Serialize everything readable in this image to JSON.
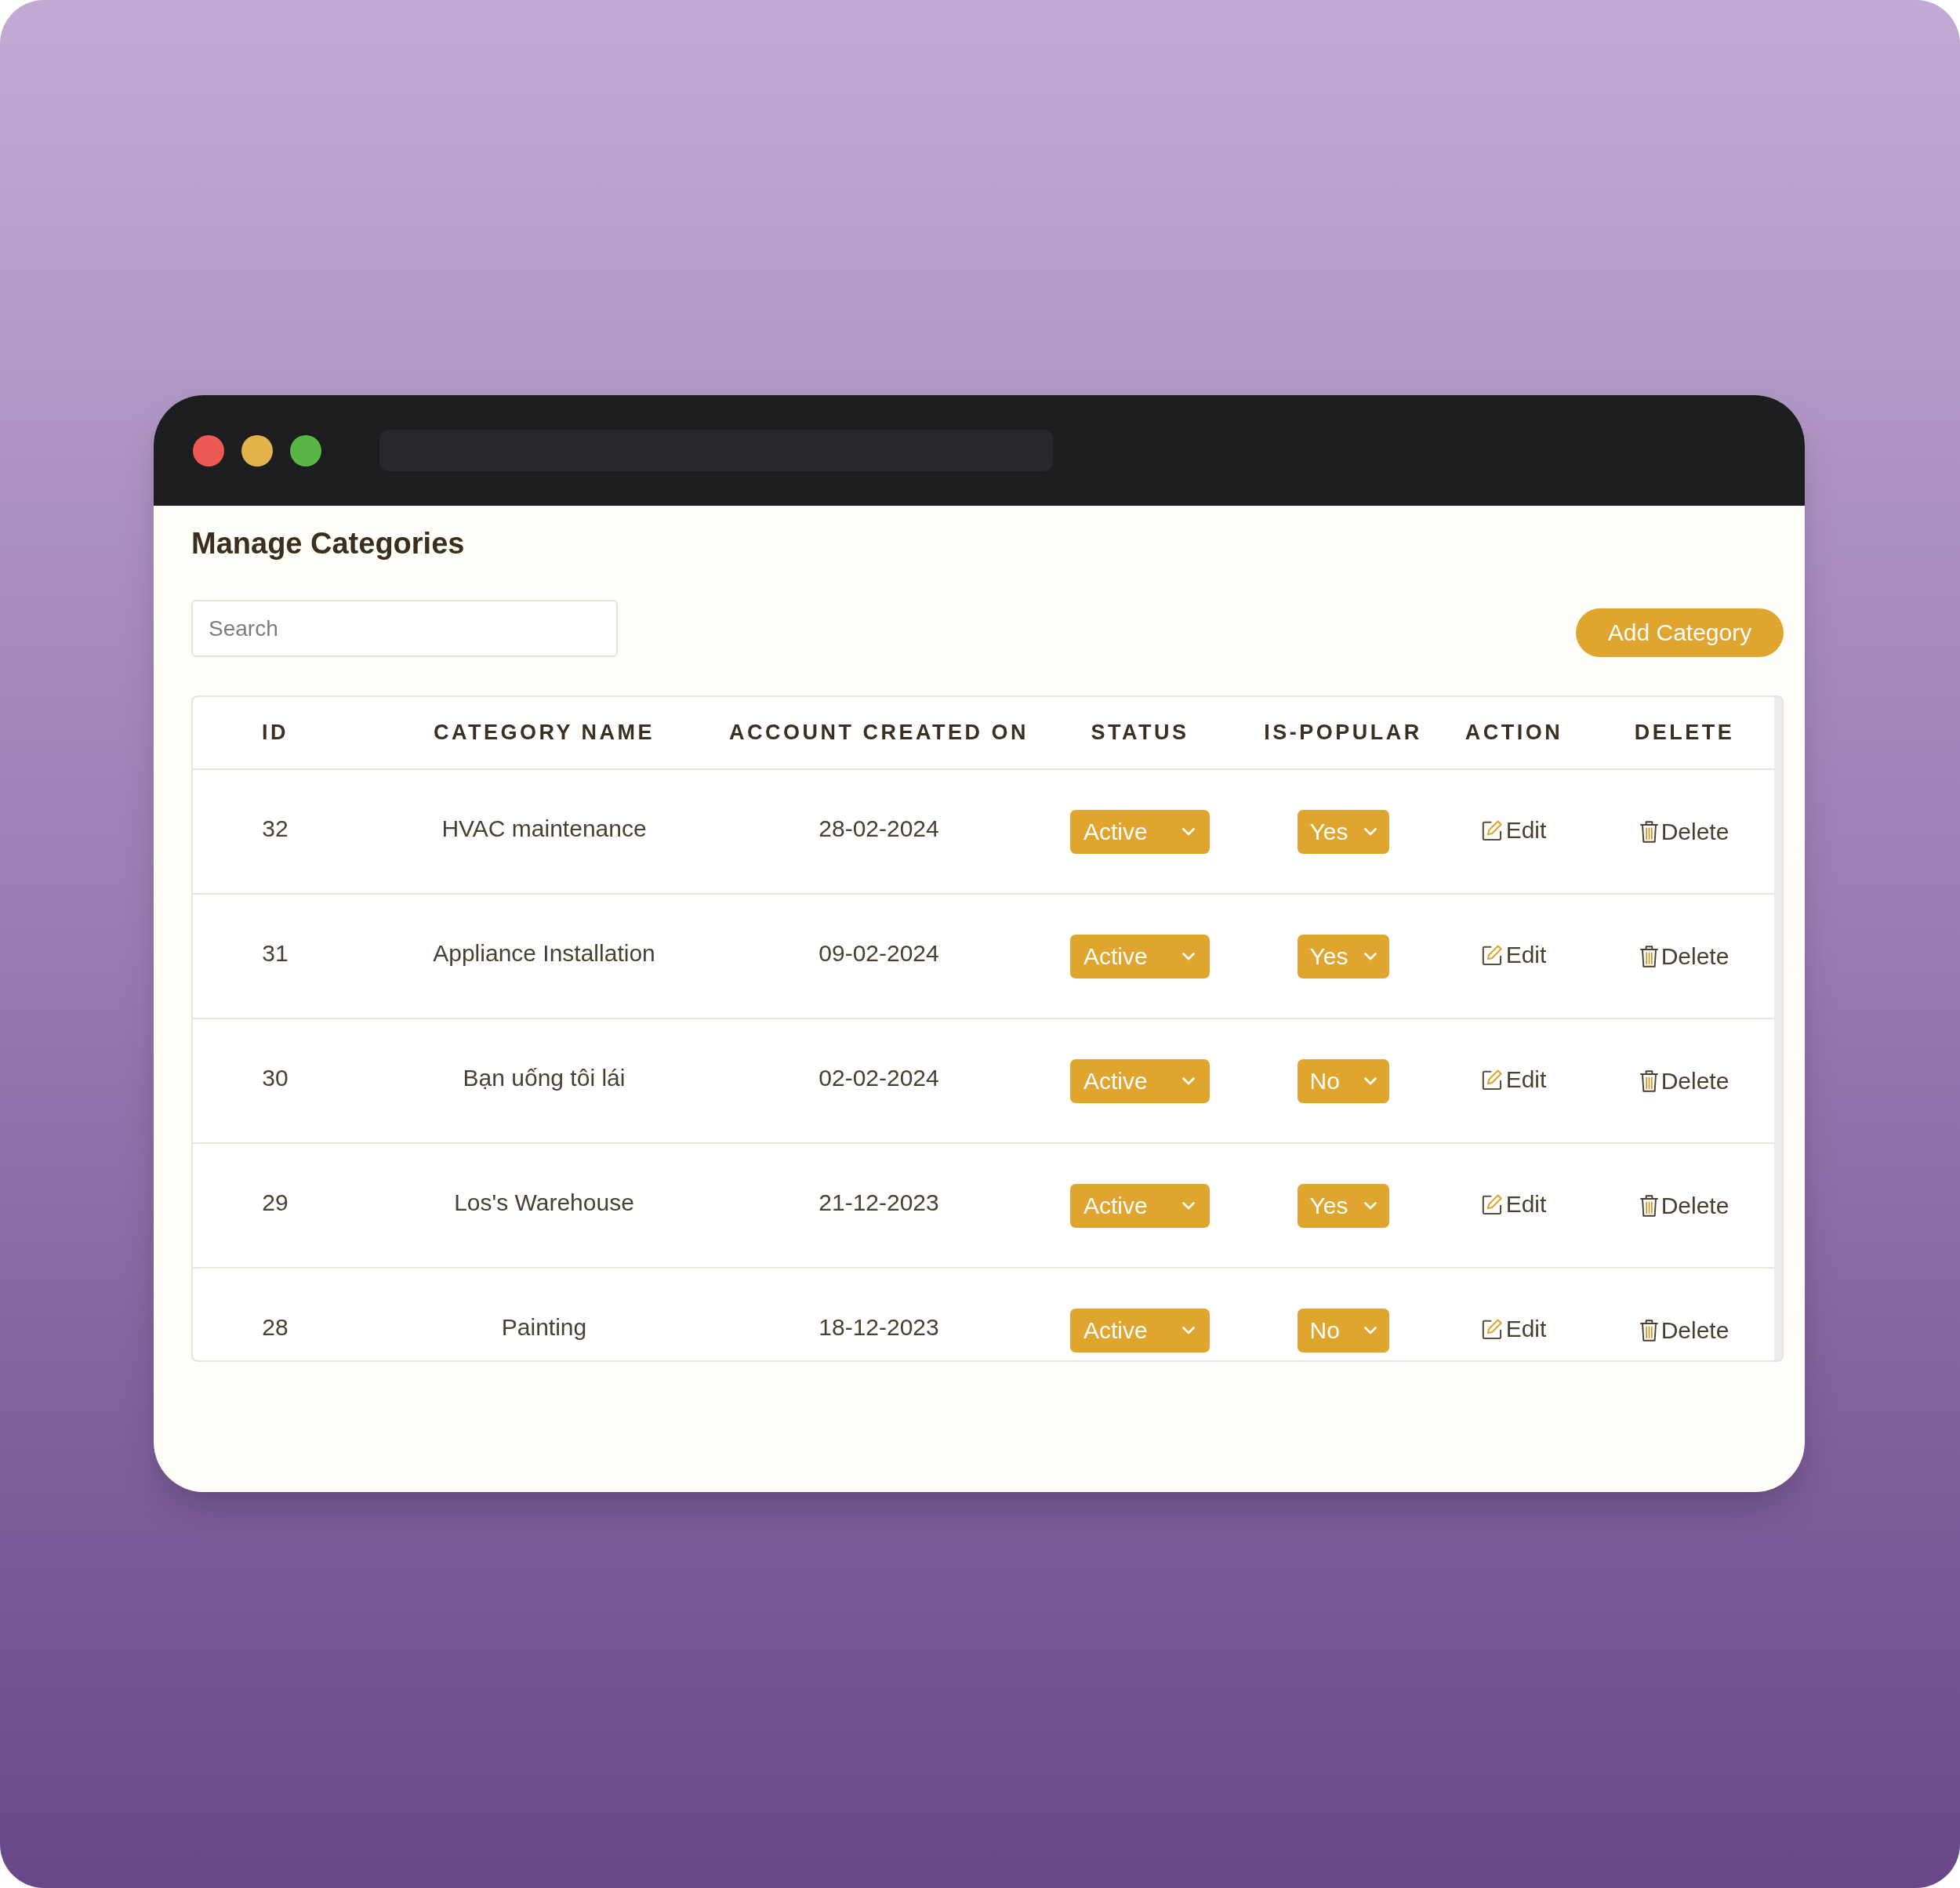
{
  "page": {
    "title": "Manage Categories",
    "search": {
      "placeholder": "Search"
    },
    "add_button": "Add Category"
  },
  "table": {
    "columns": [
      "ID",
      "CATEGORY NAME",
      "ACCOUNT CREATED ON",
      "STATUS",
      "IS-POPULAR",
      "ACTION",
      "DELETE"
    ],
    "rows": [
      {
        "id": "32",
        "category_name": "HVAC maintenance",
        "created_on": "28-02-2024",
        "status": "Active",
        "is_popular": "Yes",
        "action": "Edit",
        "delete": "Delete"
      },
      {
        "id": "31",
        "category_name": "Appliance Installation",
        "created_on": "09-02-2024",
        "status": "Active",
        "is_popular": "Yes",
        "action": "Edit",
        "delete": "Delete"
      },
      {
        "id": "30",
        "category_name": "Bạn uống tôi lái",
        "created_on": "02-02-2024",
        "status": "Active",
        "is_popular": "No",
        "action": "Edit",
        "delete": "Delete"
      },
      {
        "id": "29",
        "category_name": "Los's Warehouse",
        "created_on": "21-12-2023",
        "status": "Active",
        "is_popular": "Yes",
        "action": "Edit",
        "delete": "Delete"
      },
      {
        "id": "28",
        "category_name": "Painting",
        "created_on": "18-12-2023",
        "status": "Active",
        "is_popular": "No",
        "action": "Edit",
        "delete": "Delete"
      }
    ]
  }
}
